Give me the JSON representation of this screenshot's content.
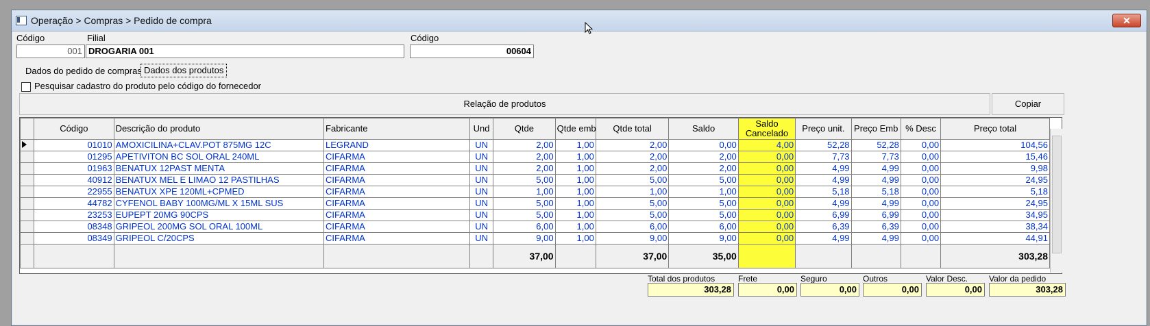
{
  "window": {
    "title": "Operação > Compras > Pedido de compra",
    "close_label": "✕"
  },
  "header": {
    "codigo_label": "Código",
    "codigo_value": "001",
    "filial_label": "Filial",
    "filial_value": "DROGARIA 001",
    "codigo2_label": "Código",
    "codigo2_value": "00604"
  },
  "tabs": [
    {
      "label": "Dados do pedido de compras"
    },
    {
      "label": "Dados dos produtos"
    }
  ],
  "options": {
    "search_by_supplier_label": "Pesquisar cadastro do produto pelo código do fornecedor"
  },
  "panel": {
    "title": "Relação de produtos",
    "copy_label": "Copiar"
  },
  "grid": {
    "columns": [
      "Código",
      "Descrição do produto",
      "Fabricante",
      "Und",
      "Qtde",
      "Qtde emb",
      "Qtde total",
      "Saldo",
      "Saldo Cancelado",
      "Preço unit.",
      "Preço Emb",
      "% Desc",
      "Preço total"
    ],
    "rows": [
      {
        "codigo": "01010",
        "descricao": "AMOXICILINA+CLAV.POT 875MG 12C",
        "fabricante": "LEGRAND",
        "und": "UN",
        "qtde": "2,00",
        "qtde_emb": "1,00",
        "qtde_total": "2,00",
        "saldo": "0,00",
        "saldo_cancelado": "4,00",
        "preco_unit": "52,28",
        "preco_emb": "52,28",
        "desc": "0,00",
        "preco_total": "104,56"
      },
      {
        "codigo": "01295",
        "descricao": "APETIVITON BC SOL ORAL 240ML",
        "fabricante": "CIFARMA",
        "und": "UN",
        "qtde": "2,00",
        "qtde_emb": "1,00",
        "qtde_total": "2,00",
        "saldo": "2,00",
        "saldo_cancelado": "0,00",
        "preco_unit": "7,73",
        "preco_emb": "7,73",
        "desc": "0,00",
        "preco_total": "15,46"
      },
      {
        "codigo": "01963",
        "descricao": "BENATUX 12PAST MENTA",
        "fabricante": "CIFARMA",
        "und": "UN",
        "qtde": "2,00",
        "qtde_emb": "1,00",
        "qtde_total": "2,00",
        "saldo": "2,00",
        "saldo_cancelado": "0,00",
        "preco_unit": "4,99",
        "preco_emb": "4,99",
        "desc": "0,00",
        "preco_total": "9,98"
      },
      {
        "codigo": "40912",
        "descricao": "BENATUX MEL E LIMAO 12 PASTILHAS",
        "fabricante": "CIFARMA",
        "und": "UN",
        "qtde": "5,00",
        "qtde_emb": "1,00",
        "qtde_total": "5,00",
        "saldo": "5,00",
        "saldo_cancelado": "0,00",
        "preco_unit": "4,99",
        "preco_emb": "4,99",
        "desc": "0,00",
        "preco_total": "24,95"
      },
      {
        "codigo": "22955",
        "descricao": "BENATUX XPE 120ML+CPMED",
        "fabricante": "CIFARMA",
        "und": "UN",
        "qtde": "1,00",
        "qtde_emb": "1,00",
        "qtde_total": "1,00",
        "saldo": "1,00",
        "saldo_cancelado": "0,00",
        "preco_unit": "5,18",
        "preco_emb": "5,18",
        "desc": "0,00",
        "preco_total": "5,18"
      },
      {
        "codigo": "44782",
        "descricao": "CYFENOL BABY 100MG/ML X 15ML SUS",
        "fabricante": "CIFARMA",
        "und": "UN",
        "qtde": "5,00",
        "qtde_emb": "1,00",
        "qtde_total": "5,00",
        "saldo": "5,00",
        "saldo_cancelado": "0,00",
        "preco_unit": "4,99",
        "preco_emb": "4,99",
        "desc": "0,00",
        "preco_total": "24,95"
      },
      {
        "codigo": "23253",
        "descricao": "EUPEPT 20MG 90CPS",
        "fabricante": "CIFARMA",
        "und": "UN",
        "qtde": "5,00",
        "qtde_emb": "1,00",
        "qtde_total": "5,00",
        "saldo": "5,00",
        "saldo_cancelado": "0,00",
        "preco_unit": "6,99",
        "preco_emb": "6,99",
        "desc": "0,00",
        "preco_total": "34,95"
      },
      {
        "codigo": "08348",
        "descricao": "GRIPEOL 200MG SOL ORAL 100ML",
        "fabricante": "CIFARMA",
        "und": "UN",
        "qtde": "6,00",
        "qtde_emb": "1,00",
        "qtde_total": "6,00",
        "saldo": "6,00",
        "saldo_cancelado": "0,00",
        "preco_unit": "6,39",
        "preco_emb": "6,39",
        "desc": "0,00",
        "preco_total": "38,34"
      },
      {
        "codigo": "08349",
        "descricao": "GRIPEOL C/20CPS",
        "fabricante": "CIFARMA",
        "und": "UN",
        "qtde": "9,00",
        "qtde_emb": "1,00",
        "qtde_total": "9,00",
        "saldo": "9,00",
        "saldo_cancelado": "0,00",
        "preco_unit": "4,99",
        "preco_emb": "4,99",
        "desc": "0,00",
        "preco_total": "44,91"
      }
    ],
    "totals": {
      "qtde": "37,00",
      "qtde_total": "37,00",
      "saldo": "35,00",
      "preco_total": "303,28"
    }
  },
  "footer": {
    "total_produtos_label": "Total dos produtos",
    "total_produtos_value": "303,28",
    "frete_label": "Frete",
    "frete_value": "0,00",
    "seguro_label": "Seguro",
    "seguro_value": "0,00",
    "outros_label": "Outros",
    "outros_value": "0,00",
    "valor_desc_label": "Valor Desc.",
    "valor_desc_value": "0,00",
    "valor_pedido_label": "Valor da pedido",
    "valor_pedido_value": "303,28"
  },
  "colors": {
    "highlight": "#fdfd3a",
    "row_text": "#0033cc",
    "input_yellow": "#ffffc8"
  }
}
